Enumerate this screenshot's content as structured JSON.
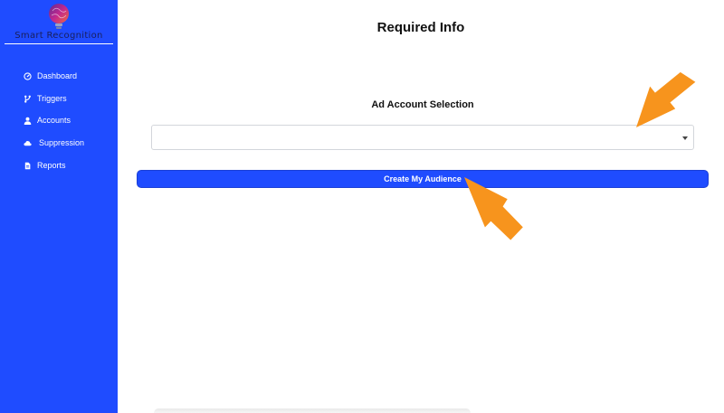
{
  "brand": {
    "name": "Smart Recognition",
    "colors": {
      "sidebar": "#1f4cff",
      "button": "#1f4cff",
      "annotation_arrow": "#f7941d"
    }
  },
  "sidebar": {
    "items": [
      {
        "label": "Dashboard",
        "icon": "dashboard-icon"
      },
      {
        "label": "Triggers",
        "icon": "branch-icon"
      },
      {
        "label": "Accounts",
        "icon": "user-icon"
      },
      {
        "label": "Suppression",
        "icon": "cloud-icon"
      },
      {
        "label": "Reports",
        "icon": "document-icon"
      }
    ]
  },
  "main": {
    "title": "Required Info",
    "ad_account": {
      "label": "Ad Account Selection",
      "value": ""
    },
    "submit_label": "Create My Audience"
  }
}
